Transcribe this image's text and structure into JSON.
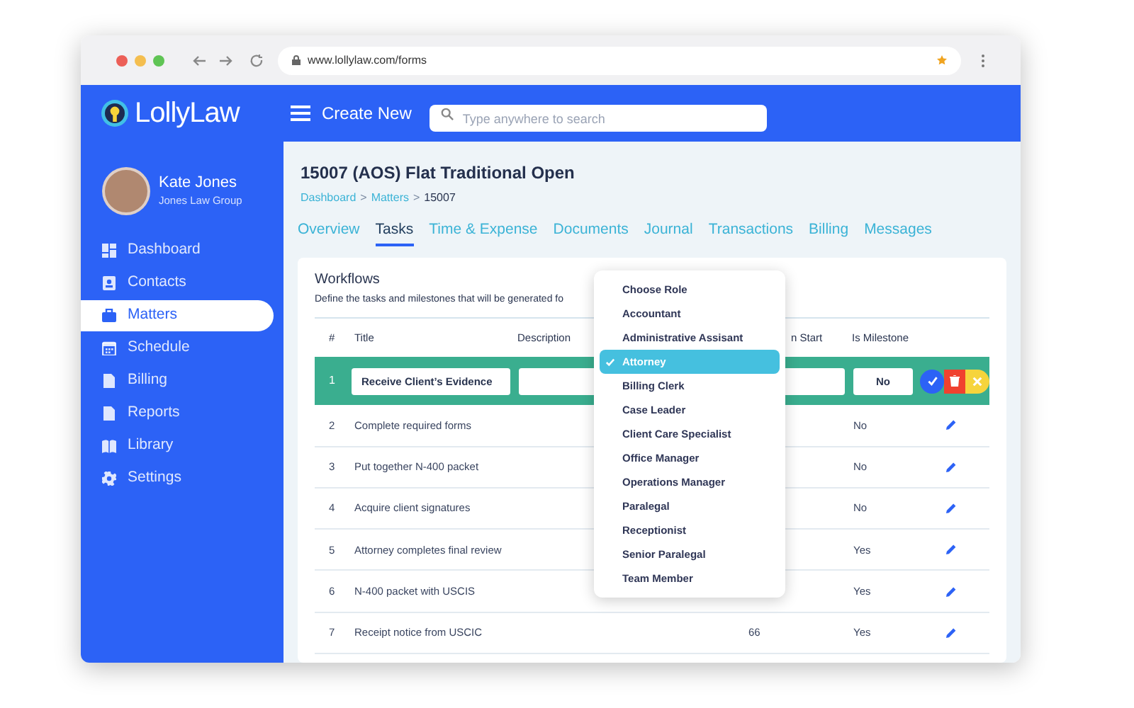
{
  "browser": {
    "url": "www.lollylaw.com/forms"
  },
  "app": {
    "logo": "LollyLaw",
    "create_new": "Create New",
    "search": {
      "placeholder": "Type anywhere to search"
    }
  },
  "user": {
    "name": "Kate Jones",
    "firm": "Jones Law Group"
  },
  "sidebar": {
    "items": [
      {
        "label": "Dashboard",
        "selected": false
      },
      {
        "label": "Contacts",
        "selected": false
      },
      {
        "label": "Matters",
        "selected": true
      },
      {
        "label": "Schedule",
        "selected": false
      },
      {
        "label": "Billing",
        "selected": false
      },
      {
        "label": "Reports",
        "selected": false
      },
      {
        "label": "Library",
        "selected": false
      },
      {
        "label": "Settings",
        "selected": false
      }
    ]
  },
  "matter": {
    "title": "15007 (AOS) Flat Traditional Open",
    "breadcrumb": [
      "Dashboard",
      "Matters",
      "15007"
    ],
    "separator": ">"
  },
  "tabs": [
    {
      "label": "Overview",
      "selected": false
    },
    {
      "label": "Tasks",
      "selected": true
    },
    {
      "label": "Time & Expense",
      "selected": false
    },
    {
      "label": "Documents",
      "selected": false
    },
    {
      "label": "Journal",
      "selected": false
    },
    {
      "label": "Transactions",
      "selected": false
    },
    {
      "label": "Billing",
      "selected": false
    },
    {
      "label": "Messages",
      "selected": false
    }
  ],
  "workflows": {
    "title": "Workflows",
    "description": "Define the tasks and milestones that will be generated fo",
    "table": {
      "columns": [
        "#",
        "Title",
        "Description",
        "n Start",
        "Is Milestone"
      ],
      "editing_row": {
        "number": "1",
        "title": "Receive Client’s Evidence",
        "is_milestone": "No"
      },
      "rows": [
        {
          "number": "2",
          "title": "Complete required forms",
          "column_4": "",
          "is_milestone": "No"
        },
        {
          "number": "3",
          "title": "Put together N-400 packet",
          "column_4": "",
          "is_milestone": "No"
        },
        {
          "number": "4",
          "title": "Acquire client signatures",
          "column_4": "",
          "is_milestone": "No"
        },
        {
          "number": "5",
          "title": "Attorney completes final review",
          "column_4": "",
          "is_milestone": "Yes"
        },
        {
          "number": "6",
          "title": "N-400 packet with USCIS",
          "column_4": "",
          "is_milestone": "Yes"
        },
        {
          "number": "7",
          "title": "Receipt notice from USCIC",
          "column_4": "66",
          "is_milestone": "Yes"
        }
      ]
    }
  },
  "role_dropdown": {
    "items": [
      {
        "label": "Choose Role",
        "selected": false
      },
      {
        "label": "Accountant",
        "selected": false
      },
      {
        "label": "Administrative Assisant",
        "selected": false
      },
      {
        "label": "Attorney",
        "selected": true
      },
      {
        "label": "Billing Clerk",
        "selected": false
      },
      {
        "label": "Case Leader",
        "selected": false
      },
      {
        "label": "Client Care Specialist",
        "selected": false
      },
      {
        "label": "Office Manager",
        "selected": false
      },
      {
        "label": "Operations Manager",
        "selected": false
      },
      {
        "label": "Paralegal",
        "selected": false
      },
      {
        "label": "Receptionist",
        "selected": false
      },
      {
        "label": "Senior Paralegal",
        "selected": false
      },
      {
        "label": "Team Member",
        "selected": false
      }
    ]
  }
}
